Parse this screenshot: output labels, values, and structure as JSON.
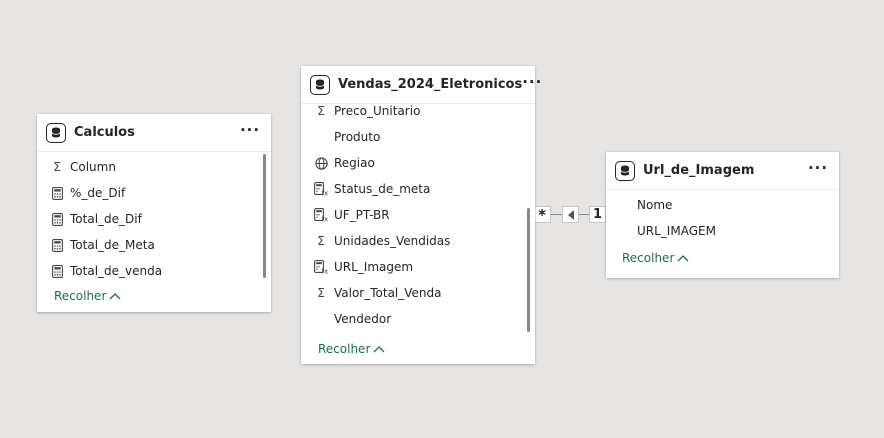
{
  "tables": {
    "calculos": {
      "title": "Calculos",
      "fields": [
        {
          "name": "Column",
          "icon": "sigma-icon"
        },
        {
          "name": "%_de_Dif",
          "icon": "calculator-icon"
        },
        {
          "name": "Total_de_Dif",
          "icon": "calculator-icon"
        },
        {
          "name": "Total_de_Meta",
          "icon": "calculator-icon"
        },
        {
          "name": "Total_de_venda",
          "icon": "calculator-icon"
        }
      ],
      "collapse_label": "Recolher"
    },
    "vendas": {
      "title": "Vendas_2024_Eletronicos",
      "fields": [
        {
          "name": "Preco_Unitario",
          "icon": "sigma-icon"
        },
        {
          "name": "Produto",
          "icon": "none"
        },
        {
          "name": "Regiao",
          "icon": "globe-icon"
        },
        {
          "name": "Status_de_meta",
          "icon": "calculated-column-icon"
        },
        {
          "name": "UF_PT-BR",
          "icon": "calculated-column-icon"
        },
        {
          "name": "Unidades_Vendidas",
          "icon": "sigma-icon"
        },
        {
          "name": "URL_Imagem",
          "icon": "calculated-column-icon"
        },
        {
          "name": "Valor_Total_Venda",
          "icon": "sigma-icon"
        },
        {
          "name": "Vendedor",
          "icon": "none"
        }
      ],
      "collapse_label": "Recolher"
    },
    "url_imagem": {
      "title": "Url_de_Imagem",
      "fields": [
        {
          "name": "Nome",
          "icon": "none"
        },
        {
          "name": "URL_IMAGEM",
          "icon": "none"
        }
      ],
      "collapse_label": "Recolher"
    }
  },
  "relationship": {
    "many_symbol": "*",
    "one_symbol": "1",
    "direction_icon": "triangle-left-icon"
  },
  "colors": {
    "canvas": "#e6e5e3",
    "link": "#1b6b5a",
    "line": "#8a8886"
  }
}
